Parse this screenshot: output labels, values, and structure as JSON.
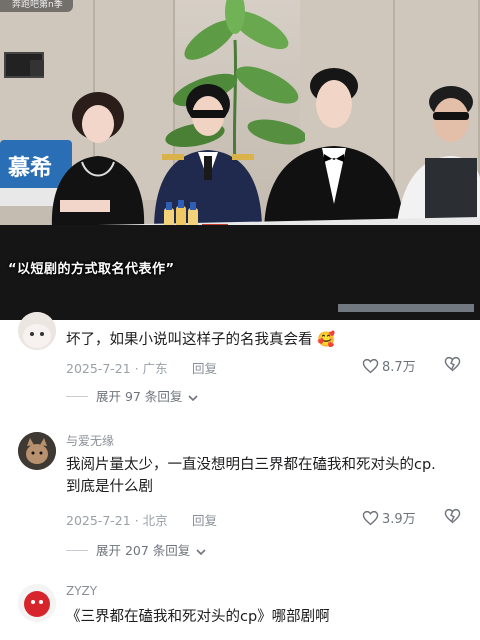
{
  "video": {
    "top_tag": "奔跑吧第n季",
    "sign_text": "慕希",
    "subtitle": "“以短剧的方式取名代表作”"
  },
  "comments": [
    {
      "username": "",
      "text": "坏了，如果小说叫这样子的名我真会看",
      "emoji": "🥰",
      "date": "2025-7-21",
      "location": "广东",
      "reply_label": "回复",
      "likes": "8.7万",
      "expand_label": "展开 97 条回复"
    },
    {
      "username": "与爱无缘",
      "text": "我阅片量太少，一直没想明白三界都在磕我和死对头的cp.到底是什么剧",
      "date": "2025-7-21",
      "location": "北京",
      "reply_label": "回复",
      "likes": "3.9万",
      "expand_label": "展开 207 条回复"
    },
    {
      "username": "ZYZY",
      "text": "《三界都在磕我和死对头的cp》哪部剧啊"
    }
  ],
  "colors": {
    "text_primary": "#1c1c1e",
    "text_meta": "#9aa0a8",
    "sign_blue": "#2a6fb5"
  },
  "icons": [
    "heart-icon",
    "dislike-icon",
    "chevron-down-icon"
  ]
}
